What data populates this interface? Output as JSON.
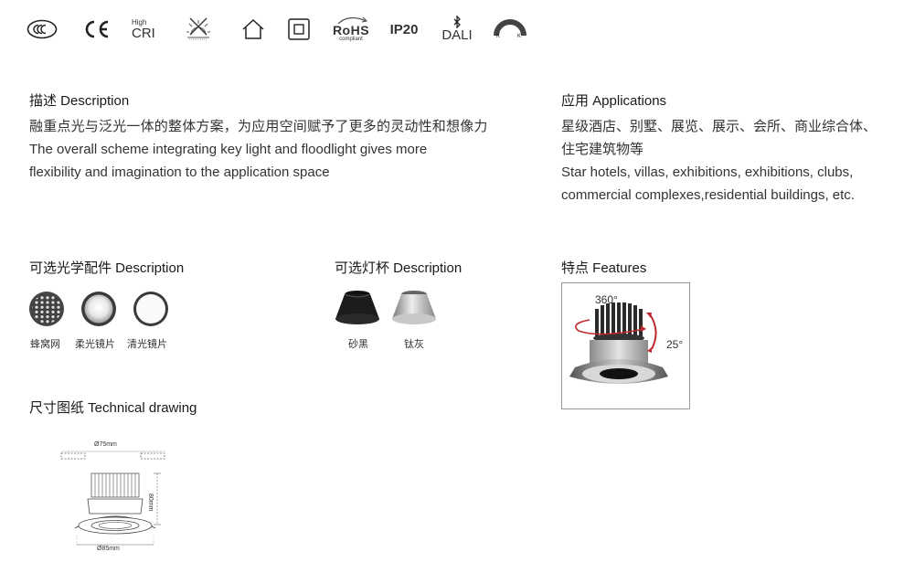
{
  "certifications": {
    "high_cri_top": "High",
    "high_cri_bottom": "CRI",
    "rohs": "RoHS",
    "rohs_sub": "compliant",
    "ip": "IP20",
    "dali": "DALI",
    "kk_left": "K",
    "kk_right": "K"
  },
  "description": {
    "heading": "描述 Description",
    "zh": "融重点光与泛光一体的整体方案，为应用空间赋予了更多的灵动性和想像力",
    "en_line1": "The overall scheme integrating key light and floodlight gives more",
    "en_line2": "flexibility and imagination to the application space"
  },
  "applications": {
    "heading": "应用 Applications",
    "zh_line1": "星级酒店、别墅、展览、展示、会所、商业综合体、",
    "zh_line2": "住宅建筑物等",
    "en_line1": "Star hotels, villas, exhibitions, exhibitions, clubs,",
    "en_line2": "commercial complexes,residential buildings, etc."
  },
  "optics": {
    "heading": "可选光学配件 Description",
    "items": [
      {
        "label": "蜂窝网"
      },
      {
        "label": "柔光镜片"
      },
      {
        "label": "清光镜片"
      }
    ]
  },
  "cups": {
    "heading": "可选灯杯 Description",
    "items": [
      {
        "label": "砂黑"
      },
      {
        "label": "钛灰"
      }
    ]
  },
  "features": {
    "heading": "特点 Features",
    "rotation": "360°",
    "tilt": "25°"
  },
  "drawing": {
    "heading": "尺寸图纸 Technical drawing",
    "cutout": "Ø75mm",
    "height": "80mm",
    "outer": "Ø85mm"
  }
}
